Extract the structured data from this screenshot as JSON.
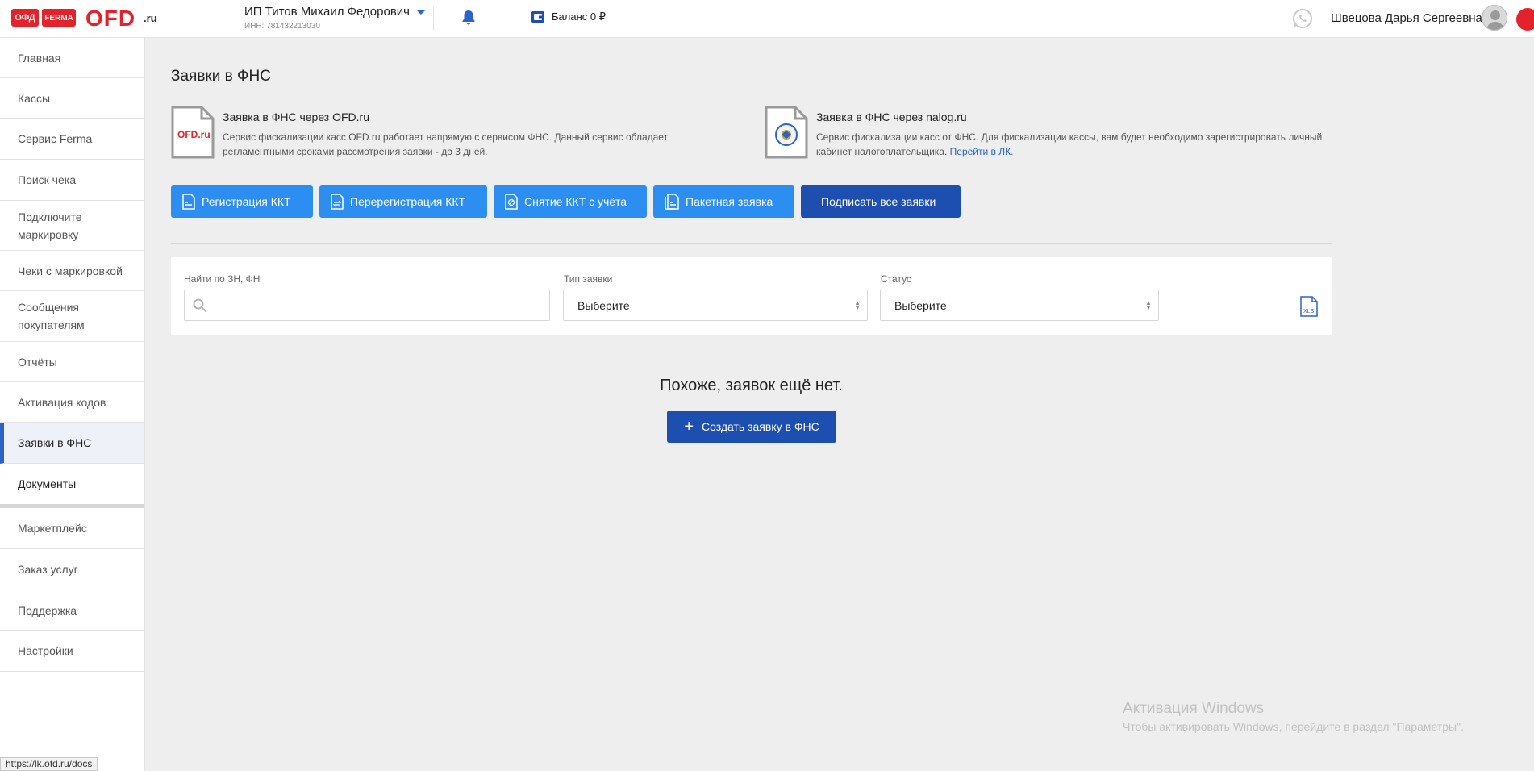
{
  "header": {
    "logo_ofd_badge": "ОФД",
    "logo_ferma_badge": "FERMA",
    "logo_main": "OFD",
    "logo_suffix": ".ru",
    "org_name": "ИП Титов Михаил Федорович",
    "org_inn": "ИНН: 781432213030",
    "balance_label": "Баланс 0 ₽",
    "user_name": "Швецова Дарья Сергеевна"
  },
  "sidebar": {
    "items": [
      {
        "label": "Главная"
      },
      {
        "label": "Кассы"
      },
      {
        "label": "Сервис Ferma"
      },
      {
        "label": "Поиск чека"
      },
      {
        "label": "Подключите маркировку"
      },
      {
        "label": "Чеки с маркировкой"
      },
      {
        "label": "Сообщения покупателям"
      },
      {
        "label": "Отчёты"
      },
      {
        "label": "Активация кодов"
      },
      {
        "label": "Заявки в ФНС",
        "active": true
      },
      {
        "label": "Документы"
      },
      {
        "label": "Маркетплейс"
      },
      {
        "label": "Заказ услуг"
      },
      {
        "label": "Поддержка"
      },
      {
        "label": "Настройки"
      }
    ]
  },
  "main": {
    "title": "Заявки в ФНС",
    "info_ofd": {
      "title": "Заявка в ФНС через OFD.ru",
      "text": "Сервис фискализации касс OFD.ru работает напрямую с сервисом ФНС. Данный сервис обладает регламентными сроками рассмотрения заявки - до 3 дней.",
      "icon_text": "OFD.ru"
    },
    "info_nalog": {
      "title": "Заявка в ФНС через nalog.ru",
      "text": "Сервис фискализации касс от ФНС. Для фискализации кассы, вам будет необходимо зарегистрировать личный кабинет налогоплательщика.",
      "link": "Перейти в ЛК."
    },
    "buttons": {
      "register": "Регистрация ККТ",
      "reregister": "Перерегистрация ККТ",
      "deregister": "Снятие ККТ с учёта",
      "batch": "Пакетная заявка",
      "sign_all": "Подписать все заявки"
    },
    "filters": {
      "search_label": "Найти по ЗН, ФН",
      "search_value": "",
      "type_label": "Тип заявки",
      "type_value": "Выберите",
      "status_label": "Статус",
      "status_value": "Выберите",
      "export_icon_text": "XLS"
    },
    "empty_message": "Похоже, заявок ещё нет.",
    "create_button": "Создать заявку в ФНС"
  },
  "windows_watermark": {
    "title": "Активация Windows",
    "subtitle": "Чтобы активировать Windows, перейдите в раздел \"Параметры\"."
  },
  "status_bar_url": "https://lk.ofd.ru/docs",
  "colors": {
    "brand_red": "#e3222c",
    "primary_blue": "#2c8ef0",
    "dark_blue": "#1d4fb0",
    "link_blue": "#2b63c6"
  }
}
